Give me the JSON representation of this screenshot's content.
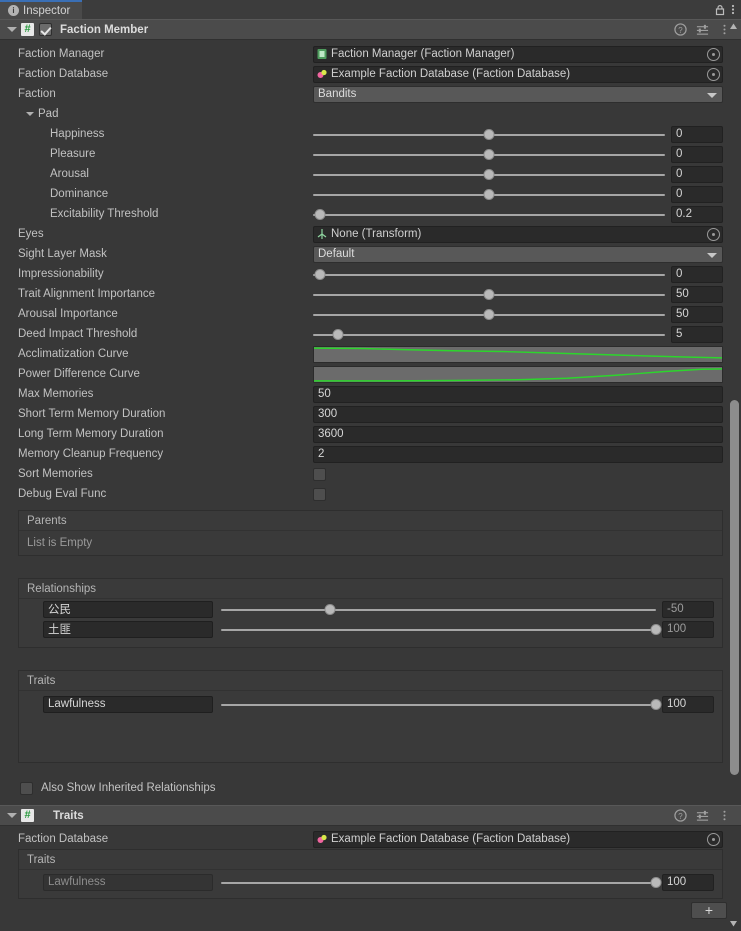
{
  "window": {
    "tab": {
      "label": "Inspector",
      "icon": "info-icon"
    },
    "accent": "#3a6fb5"
  },
  "components": [
    {
      "title": "Faction Member",
      "enabled": true,
      "icon": "cs-script-icon",
      "header_icons": [
        "help-icon",
        "preset-icon",
        "more-menu-icon"
      ]
    },
    {
      "title": "Traits",
      "icon": "cs-script-icon",
      "header_icons": [
        "help-icon",
        "preset-icon",
        "more-menu-icon"
      ]
    }
  ],
  "faction_member": {
    "faction_manager": {
      "label": "Faction Manager",
      "value": "Faction Manager (Faction Manager)",
      "icon": "gameobject-icon"
    },
    "faction_database": {
      "label": "Faction Database",
      "value": "Example Faction Database (Faction Database)",
      "icon": "scriptable-object-icon"
    },
    "faction": {
      "label": "Faction",
      "value": "Bandits"
    },
    "pad": {
      "label": "Pad",
      "rows": [
        {
          "label": "Happiness",
          "value": "0",
          "pct": 50
        },
        {
          "label": "Pleasure",
          "value": "0",
          "pct": 50
        },
        {
          "label": "Arousal",
          "value": "0",
          "pct": 50
        },
        {
          "label": "Dominance",
          "value": "0",
          "pct": 50
        },
        {
          "label": "Excitability Threshold",
          "value": "0.2",
          "pct": 2
        }
      ]
    },
    "eyes": {
      "label": "Eyes",
      "value": "None (Transform)",
      "icon": "transform-icon"
    },
    "sight_layer_mask": {
      "label": "Sight Layer Mask",
      "value": "Default"
    },
    "sliders": [
      {
        "label": "Impressionability",
        "value": "0",
        "pct": 2
      },
      {
        "label": "Trait Alignment Importance",
        "value": "50",
        "pct": 50
      },
      {
        "label": "Arousal Importance",
        "value": "50",
        "pct": 50
      },
      {
        "label": "Deed Impact Threshold",
        "value": "5",
        "pct": 7
      }
    ],
    "curves": [
      {
        "label": "Acclimatization Curve",
        "shape": "descending",
        "color": "#2cd62c"
      },
      {
        "label": "Power Difference Curve",
        "shape": "ascending",
        "color": "#2cd62c"
      }
    ],
    "fields": [
      {
        "label": "Max Memories",
        "value": "50"
      },
      {
        "label": "Short Term Memory Duration",
        "value": "300"
      },
      {
        "label": "Long Term Memory Duration",
        "value": "3600"
      },
      {
        "label": "Memory Cleanup Frequency",
        "value": "2"
      }
    ],
    "toggles": [
      {
        "label": "Sort Memories",
        "checked": false
      },
      {
        "label": "Debug Eval Func",
        "checked": false
      }
    ],
    "parents": {
      "title": "Parents",
      "empty_text": "List is Empty"
    },
    "relationships": {
      "title": "Relationships",
      "rows": [
        {
          "name": "公民",
          "value": "-50",
          "pct": 25
        },
        {
          "name": "土匪",
          "value": "100",
          "pct": 100
        }
      ]
    },
    "traits": {
      "title": "Traits",
      "rows": [
        {
          "name": "Lawfulness",
          "value": "100",
          "pct": 100
        }
      ]
    },
    "inherited_flag": {
      "label": "Also Show Inherited Relationships",
      "checked": false
    }
  },
  "traits_component": {
    "faction_database": {
      "label": "Faction Database",
      "value": "Example Faction Database (Faction Database)",
      "icon": "scriptable-object-icon"
    },
    "traits": {
      "title": "Traits",
      "rows": [
        {
          "name": "Lawfulness",
          "value": "100",
          "pct": 100,
          "dim": true
        }
      ]
    },
    "add_button": "+"
  }
}
